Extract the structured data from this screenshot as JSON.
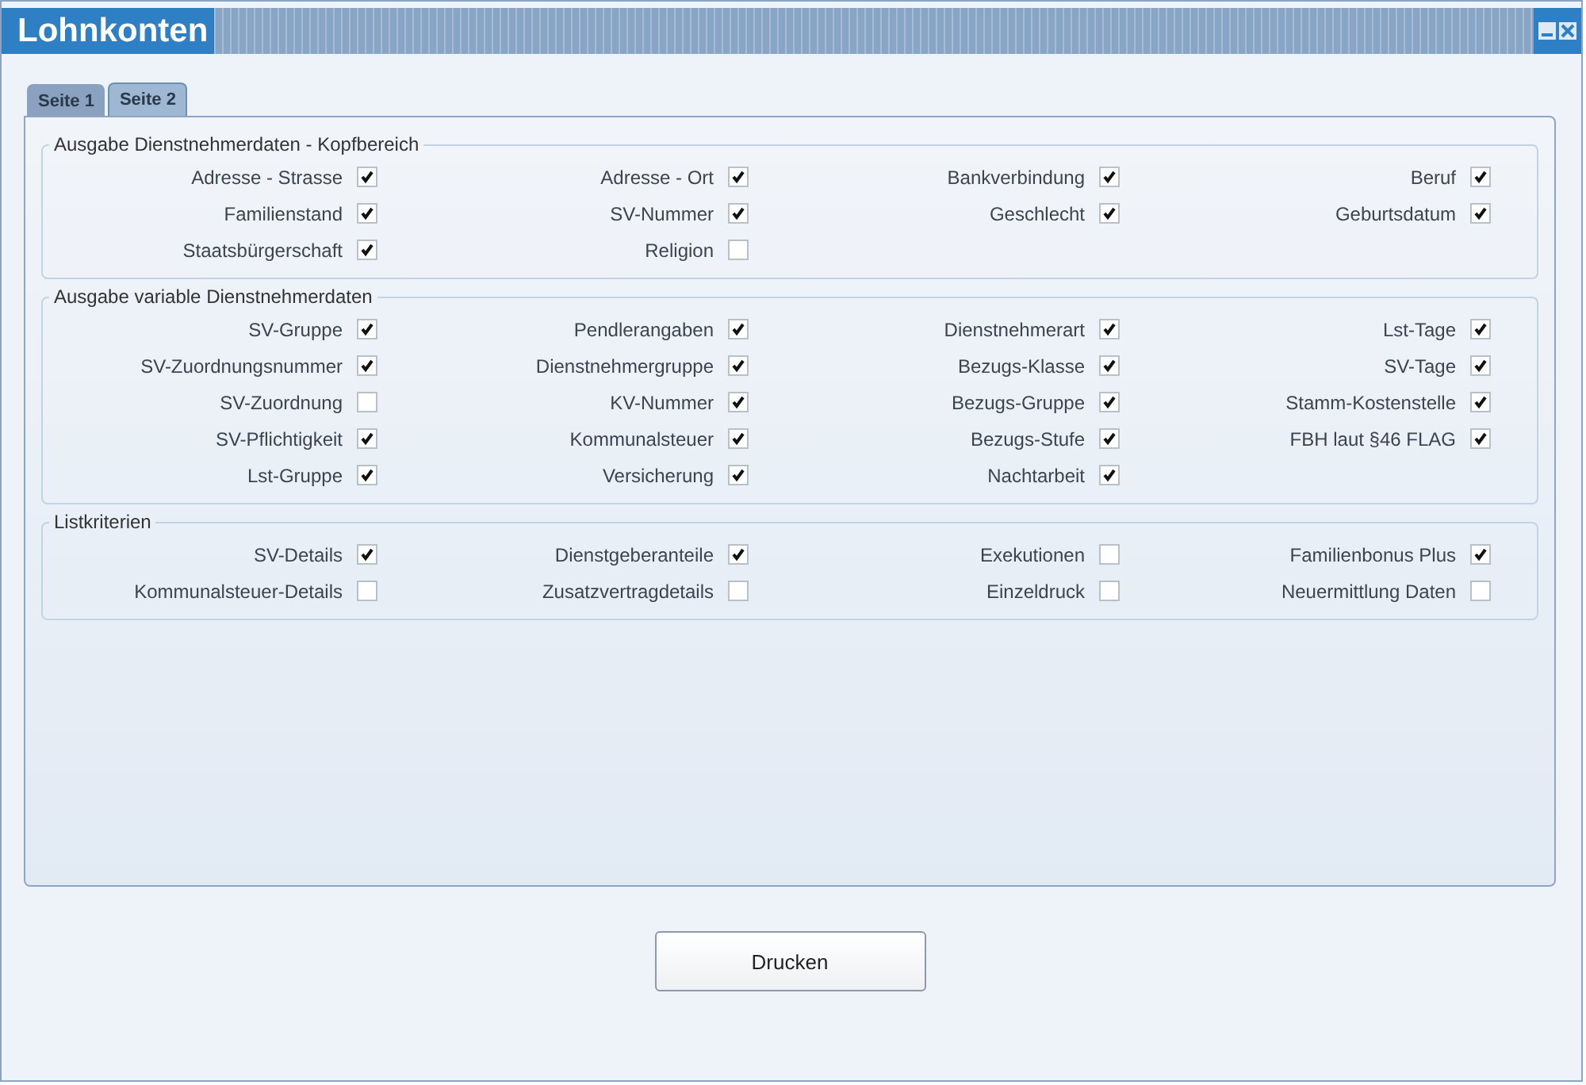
{
  "window": {
    "title": "Lohnkonten"
  },
  "tabs": [
    {
      "label": "Seite 1",
      "selected": false
    },
    {
      "label": "Seite 2",
      "selected": true
    }
  ],
  "sections": [
    {
      "title": "Ausgabe Dienstnehmerdaten - Kopfbereich",
      "rows": [
        [
          {
            "label": "Adresse - Strasse",
            "checked": true
          },
          {
            "label": "Adresse - Ort",
            "checked": true
          },
          {
            "label": "Bankverbindung",
            "checked": true
          },
          {
            "label": "Beruf",
            "checked": true
          }
        ],
        [
          {
            "label": "Familienstand",
            "checked": true
          },
          {
            "label": "SV-Nummer",
            "checked": true
          },
          {
            "label": "Geschlecht",
            "checked": true
          },
          {
            "label": "Geburtsdatum",
            "checked": true
          }
        ],
        [
          {
            "label": "Staatsbürgerschaft",
            "checked": true
          },
          {
            "label": "Religion",
            "checked": false
          }
        ]
      ]
    },
    {
      "title": "Ausgabe variable Dienstnehmerdaten",
      "rows": [
        [
          {
            "label": "SV-Gruppe",
            "checked": true
          },
          {
            "label": "Pendlerangaben",
            "checked": true
          },
          {
            "label": "Dienstnehmerart",
            "checked": true
          },
          {
            "label": "Lst-Tage",
            "checked": true
          }
        ],
        [
          {
            "label": "SV-Zuordnungsnummer",
            "checked": true
          },
          {
            "label": "Dienstnehmergruppe",
            "checked": true
          },
          {
            "label": "Bezugs-Klasse",
            "checked": true
          },
          {
            "label": "SV-Tage",
            "checked": true
          }
        ],
        [
          {
            "label": "SV-Zuordnung",
            "checked": false
          },
          {
            "label": "KV-Nummer",
            "checked": true
          },
          {
            "label": "Bezugs-Gruppe",
            "checked": true
          },
          {
            "label": "Stamm-Kostenstelle",
            "checked": true
          }
        ],
        [
          {
            "label": "SV-Pflichtigkeit",
            "checked": true
          },
          {
            "label": "Kommunalsteuer",
            "checked": true
          },
          {
            "label": "Bezugs-Stufe",
            "checked": true
          },
          {
            "label": "FBH laut §46 FLAG",
            "checked": true
          }
        ],
        [
          {
            "label": "Lst-Gruppe",
            "checked": true
          },
          {
            "label": "Versicherung",
            "checked": true
          },
          {
            "label": "Nachtarbeit",
            "checked": true
          }
        ]
      ]
    },
    {
      "title": "Listkriterien",
      "rows": [
        [
          {
            "label": "SV-Details",
            "checked": true
          },
          {
            "label": "Dienstgeberanteile",
            "checked": true
          },
          {
            "label": "Exekutionen",
            "checked": false
          },
          {
            "label": "Familienbonus Plus",
            "checked": true
          }
        ],
        [
          {
            "label": "Kommunalsteuer-Details",
            "checked": false
          },
          {
            "label": "Zusatzvertragdetails",
            "checked": false
          },
          {
            "label": "Einzeldruck",
            "checked": false
          },
          {
            "label": "Neuermittlung Daten",
            "checked": false
          }
        ]
      ]
    }
  ],
  "button": "Drucken"
}
